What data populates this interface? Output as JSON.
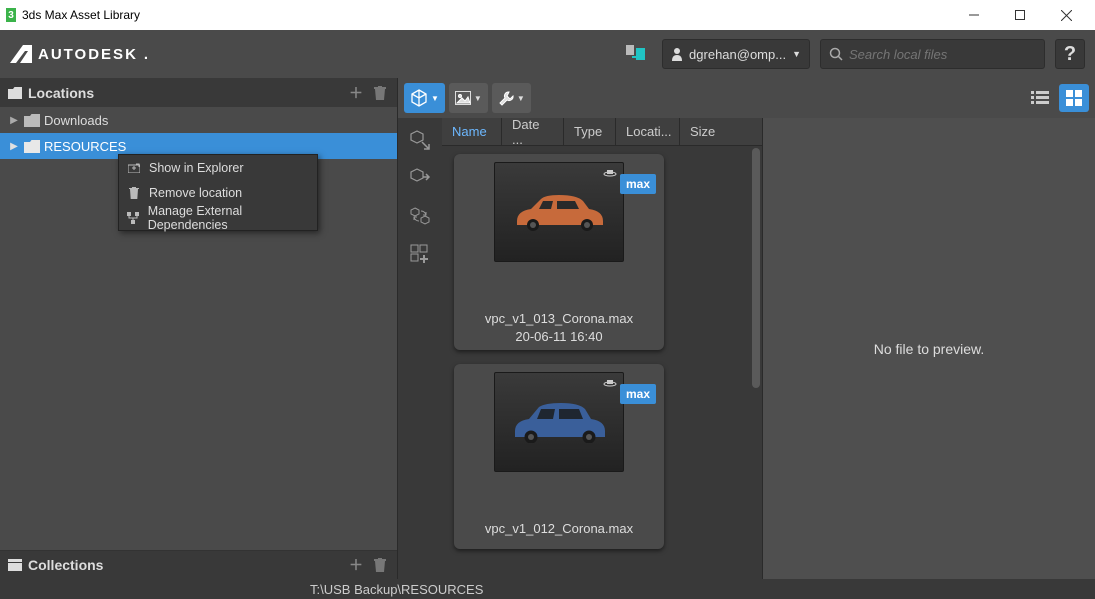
{
  "window": {
    "title": "3ds Max Asset Library"
  },
  "brand": "AUTODESK",
  "header": {
    "user_label": "dgrehan@omp...",
    "search_placeholder": "Search local files"
  },
  "sidebar": {
    "locations_title": "Locations",
    "collections_title": "Collections",
    "tree": [
      {
        "label": "Downloads",
        "selected": false
      },
      {
        "label": "RESOURCES",
        "selected": true
      }
    ]
  },
  "context_menu": {
    "items": [
      {
        "label": "Show in Explorer"
      },
      {
        "label": "Remove location"
      },
      {
        "label": "Manage External Dependencies"
      }
    ]
  },
  "columns": [
    "Name",
    "Date ...",
    "Type",
    "Locati...",
    "Size"
  ],
  "assets": [
    {
      "name": "vpc_v1_013_Corona.max",
      "date": "20-06-11 16:40",
      "badge": "max",
      "color": "#c76a3b"
    },
    {
      "name": "vpc_v1_012_Corona.max",
      "date": "",
      "badge": "max",
      "color": "#3a5f9a"
    }
  ],
  "preview": {
    "empty_text": "No file to preview."
  },
  "status": {
    "path": "T:\\USB Backup\\RESOURCES"
  }
}
